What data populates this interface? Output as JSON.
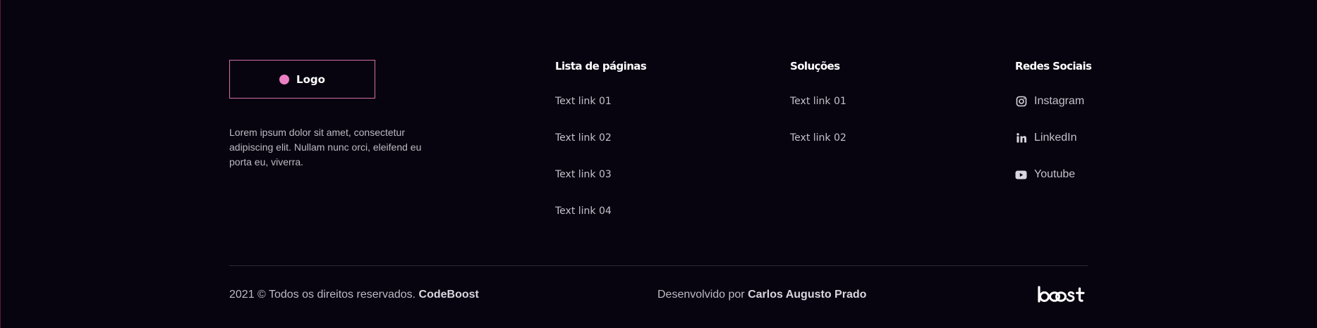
{
  "logo": {
    "label": "Logo"
  },
  "about": {
    "description": "Lorem ipsum dolor sit amet, consectetur adipiscing elit. Nullam nunc orci, eleifend eu porta eu, viverra."
  },
  "pages": {
    "title": "Lista de páginas",
    "links": [
      "Text link 01",
      "Text link 02",
      "Text link 03",
      "Text link 04"
    ]
  },
  "solutions": {
    "title": "Soluções",
    "links": [
      "Text link 01",
      "Text link 02"
    ]
  },
  "social": {
    "title": "Redes Sociais",
    "items": [
      {
        "label": "Instagram",
        "icon": "instagram-icon"
      },
      {
        "label": "LinkedIn",
        "icon": "linkedin-icon"
      },
      {
        "label": "Youtube",
        "icon": "youtube-icon"
      }
    ]
  },
  "bottom": {
    "copyright_prefix": "2021 © Todos os direitos reservados.",
    "company": "CodeBoost",
    "developed_prefix": "Desenvolvido por",
    "developer": "Carlos Augusto Prado"
  },
  "brand": {
    "logo_text": "boost"
  },
  "colors": {
    "background": "#07040f",
    "accent": "#ec7fc4",
    "logo_border": "#d76fa8",
    "divider": "#2c2934"
  }
}
